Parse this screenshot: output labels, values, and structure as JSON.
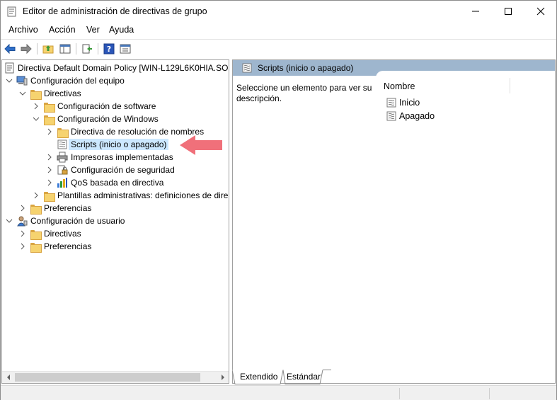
{
  "window": {
    "title": "Editor de administración de directivas de grupo",
    "controls": [
      "minimize-icon",
      "maximize-icon",
      "close-icon"
    ]
  },
  "menu": {
    "items": [
      "Archivo",
      "Acción",
      "Ver",
      "Ayuda"
    ]
  },
  "toolbar": {
    "buttons": [
      "back-icon",
      "forward-icon",
      "up-folder-icon",
      "show-hide-tree-icon",
      "export-list-icon",
      "help-icon",
      "properties-icon"
    ]
  },
  "tree": {
    "root": "Directiva Default Domain Policy [WIN-L129L6K0HIA.SOL",
    "items": [
      {
        "label": "Configuración del equipo"
      },
      {
        "label": "Directivas"
      },
      {
        "label": "Configuración de software"
      },
      {
        "label": "Configuración de Windows"
      },
      {
        "label": "Directiva de resolución de nombres"
      },
      {
        "label": "Scripts (inicio o apagado)"
      },
      {
        "label": "Impresoras implementadas"
      },
      {
        "label": "Configuración de seguridad"
      },
      {
        "label": "QoS basada en directiva"
      },
      {
        "label": "Plantillas administrativas: definiciones de dire"
      },
      {
        "label": "Preferencias"
      },
      {
        "label": "Configuración de usuario"
      },
      {
        "label": "Directivas"
      },
      {
        "label": "Preferencias"
      }
    ]
  },
  "details": {
    "header": "Scripts (inicio o apagado)",
    "description": "Seleccione un elemento para ver su descripción.",
    "column": "Nombre",
    "items": [
      "Inicio",
      "Apagado"
    ]
  },
  "tabs": [
    "Extendido",
    "Estándar"
  ],
  "colors": {
    "header_bg": "#9eb6ce",
    "selection_bg": "#cce8ff",
    "arrow": "#f0707a"
  }
}
